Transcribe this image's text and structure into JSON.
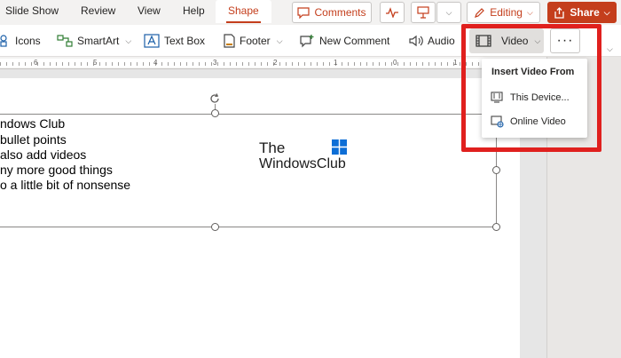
{
  "tabs": [
    {
      "label": "Slide Show",
      "active": false
    },
    {
      "label": "Review",
      "active": false
    },
    {
      "label": "View",
      "active": false
    },
    {
      "label": "Help",
      "active": false
    },
    {
      "label": "Shape",
      "active": true
    }
  ],
  "topbar": {
    "comments_label": "Comments",
    "editing_label": "Editing",
    "share_label": "Share"
  },
  "ribbon": {
    "icons_label": "Icons",
    "smartart_label": "SmartArt",
    "textbox_label": "Text Box",
    "footer_label": "Footer",
    "newcomment_label": "New Comment",
    "audio_label": "Audio",
    "video_label": "Video",
    "more_label": "···"
  },
  "ruler": {
    "numbers": [
      "6",
      "5",
      "4",
      "3",
      "2",
      "1",
      "0",
      "1"
    ]
  },
  "slide": {
    "lines": [
      "ndows Club",
      "bullet points",
      "also add videos",
      "ny more good things",
      "o a little bit of nonsense"
    ],
    "logo_line1": "The",
    "logo_line2": "WindowsClub"
  },
  "dropdown": {
    "title": "Insert Video From",
    "items": [
      "This Device...",
      "Online Video"
    ]
  },
  "colors": {
    "accent": "#c43e1c",
    "highlight": "#e0201e"
  }
}
